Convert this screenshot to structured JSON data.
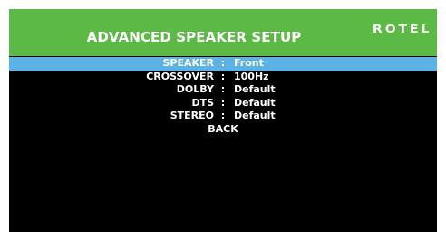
{
  "header": {
    "title": "ADVANCED SPEAKER SETUP",
    "logo": "ROTEL"
  },
  "colors": {
    "header_bg": "#5cb946",
    "highlight": "#5bb3e5",
    "screen_bg": "#000000",
    "text": "#ffffff"
  },
  "menu": {
    "separator": ":",
    "items": [
      {
        "label": "SPEAKER",
        "value": "Front",
        "selected": true
      },
      {
        "label": "CROSSOVER",
        "value": "100Hz",
        "selected": false
      },
      {
        "label": "DOLBY",
        "value": "Default",
        "selected": false
      },
      {
        "label": "DTS",
        "value": "Default",
        "selected": false
      },
      {
        "label": "STEREO",
        "value": "Default",
        "selected": false
      }
    ],
    "back_label": "BACK"
  }
}
